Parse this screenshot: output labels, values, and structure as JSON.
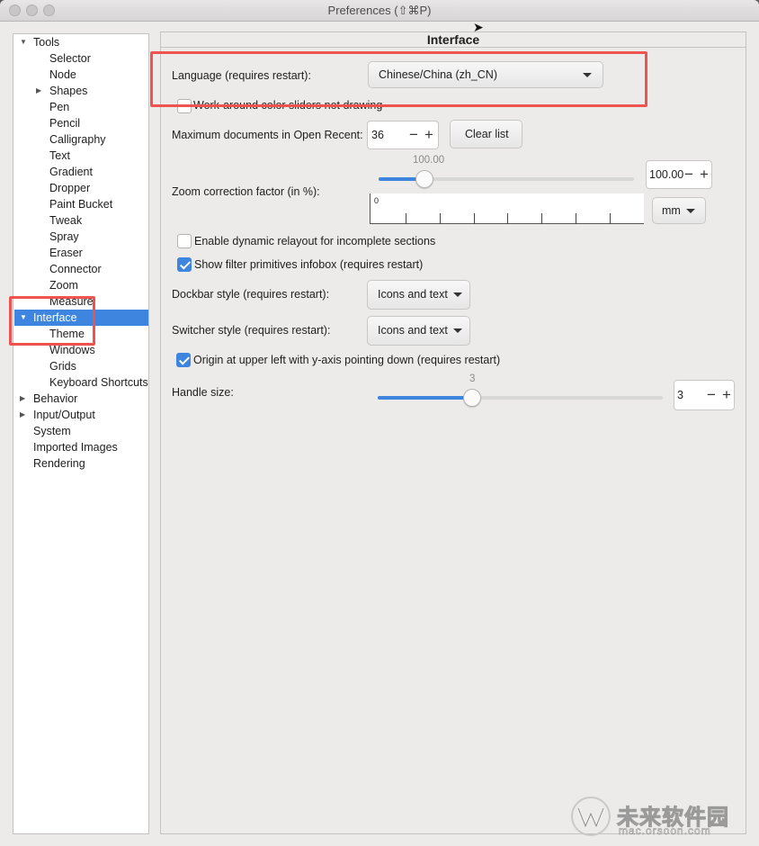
{
  "window": {
    "title": "Preferences (⇧⌘P)"
  },
  "sidebar": {
    "items": [
      {
        "label": "Tools",
        "expander": "expanded"
      },
      {
        "label": "Selector"
      },
      {
        "label": "Node"
      },
      {
        "label": "Shapes",
        "expander": "collapsed"
      },
      {
        "label": "Pen"
      },
      {
        "label": "Pencil"
      },
      {
        "label": "Calligraphy"
      },
      {
        "label": "Text"
      },
      {
        "label": "Gradient"
      },
      {
        "label": "Dropper"
      },
      {
        "label": "Paint Bucket"
      },
      {
        "label": "Tweak"
      },
      {
        "label": "Spray"
      },
      {
        "label": "Eraser"
      },
      {
        "label": "Connector"
      },
      {
        "label": "Zoom"
      },
      {
        "label": "Measure"
      },
      {
        "label": "Interface",
        "expander": "expanded",
        "selected": true
      },
      {
        "label": "Theme"
      },
      {
        "label": "Windows"
      },
      {
        "label": "Grids"
      },
      {
        "label": "Keyboard Shortcuts"
      },
      {
        "label": "Behavior",
        "expander": "collapsed"
      },
      {
        "label": "Input/Output",
        "expander": "collapsed"
      },
      {
        "label": "System"
      },
      {
        "label": "Imported Images"
      },
      {
        "label": "Rendering"
      }
    ]
  },
  "panel": {
    "title": "Interface",
    "language": {
      "label": "Language (requires restart):",
      "value": "Chinese/China (zh_CN)"
    },
    "workaround": {
      "label": "Work-around color sliders not drawing",
      "checked": false
    },
    "recent": {
      "label": "Maximum documents in Open Recent:",
      "value": "36",
      "clear_label": "Clear list"
    },
    "zoom": {
      "label": "Zoom correction factor (in %):",
      "slider_value": "100.00",
      "slider_level": 0.18,
      "field_value": "100.00",
      "unit": "mm",
      "ruler_zero": "0"
    },
    "relayout": {
      "label": "Enable dynamic relayout for incomplete sections",
      "checked": false
    },
    "filter_infobox": {
      "label": "Show filter primitives infobox (requires restart)",
      "checked": true
    },
    "dockbar": {
      "label": "Dockbar style (requires restart):",
      "value": "Icons and text"
    },
    "switcher": {
      "label": "Switcher style (requires restart):",
      "value": "Icons and text"
    },
    "origin": {
      "label": "Origin at upper left with y-axis pointing down (requires restart)",
      "checked": true
    },
    "handle": {
      "label": "Handle size:",
      "slider_value": "3",
      "slider_level": 0.33,
      "field_value": "3"
    }
  },
  "watermark": {
    "text_cn": "未来软件园",
    "url": "mac.orsoon.com"
  },
  "colors": {
    "accent": "#3d85df",
    "highlight": "#ef5350"
  }
}
